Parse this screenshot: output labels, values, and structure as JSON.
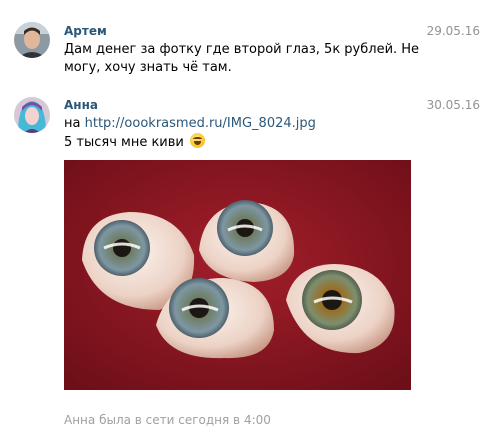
{
  "messages": [
    {
      "author": "Артем",
      "date": "29.05.16",
      "text": "Дам денег за фотку где второй глаз, 5к рублей. Не могу, хочу знать чё там."
    },
    {
      "author": "Анна",
      "date": "30.05.16",
      "text_prefix": "на ",
      "link": "http://oookrasmed.ru/IMG_8024.jpg",
      "text2": "5 тысяч мне киви",
      "emoji": "laughing-face-icon"
    }
  ],
  "status": "Анна была в сети сегодня в 4:00",
  "colors": {
    "author": "#2b587a",
    "date": "#939393",
    "status": "#a0a0a0",
    "photo_background": "#8b1722"
  }
}
